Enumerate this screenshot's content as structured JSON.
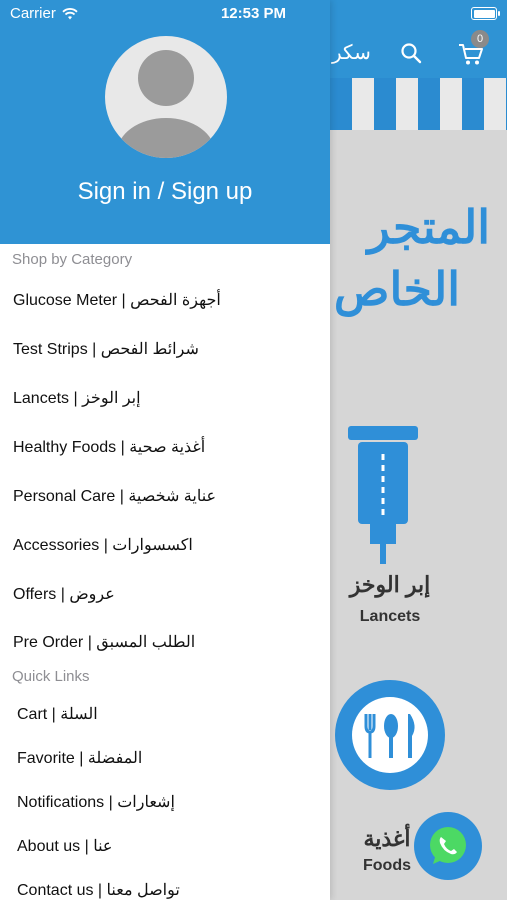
{
  "status_bar": {
    "carrier": "Carrier",
    "time": "12:53 PM",
    "battery_level": 1.0
  },
  "drawer": {
    "sign_in_label": "Sign in / Sign up",
    "shop_by_category_title": "Shop by Category",
    "categories": [
      {
        "label": "Glucose Meter | أجهزة الفحص"
      },
      {
        "label": "Test Strips | شرائط الفحص"
      },
      {
        "label": "Lancets | إبر الوخز"
      },
      {
        "label": "Healthy Foods | أغذية صحية"
      },
      {
        "label": "Personal Care | عناية شخصية"
      },
      {
        "label": "Accessories | اكسسوارات"
      },
      {
        "label": "Offers | عروض"
      },
      {
        "label": "Pre Order | الطلب المسبق"
      }
    ],
    "quick_links_title": "Quick Links",
    "quick_links": [
      {
        "label": "Cart | السلة"
      },
      {
        "label": "Favorite | المفضلة"
      },
      {
        "label": "Notifications | إشعارات"
      },
      {
        "label": "About us | عنا"
      },
      {
        "label": "Contact us | تواصل معنا"
      }
    ]
  },
  "background_screen": {
    "brand_text": "سكر",
    "cart_count": "0",
    "hero_line_1": "المتجر",
    "hero_line_2": "الخاص",
    "lancets_ar": "إبر الوخز",
    "lancets_en": "Lancets",
    "foods_ar": "أغذية",
    "foods_en": "Foods"
  },
  "colors": {
    "accent": "#2f93d4",
    "section_title": "#8e8e93"
  }
}
